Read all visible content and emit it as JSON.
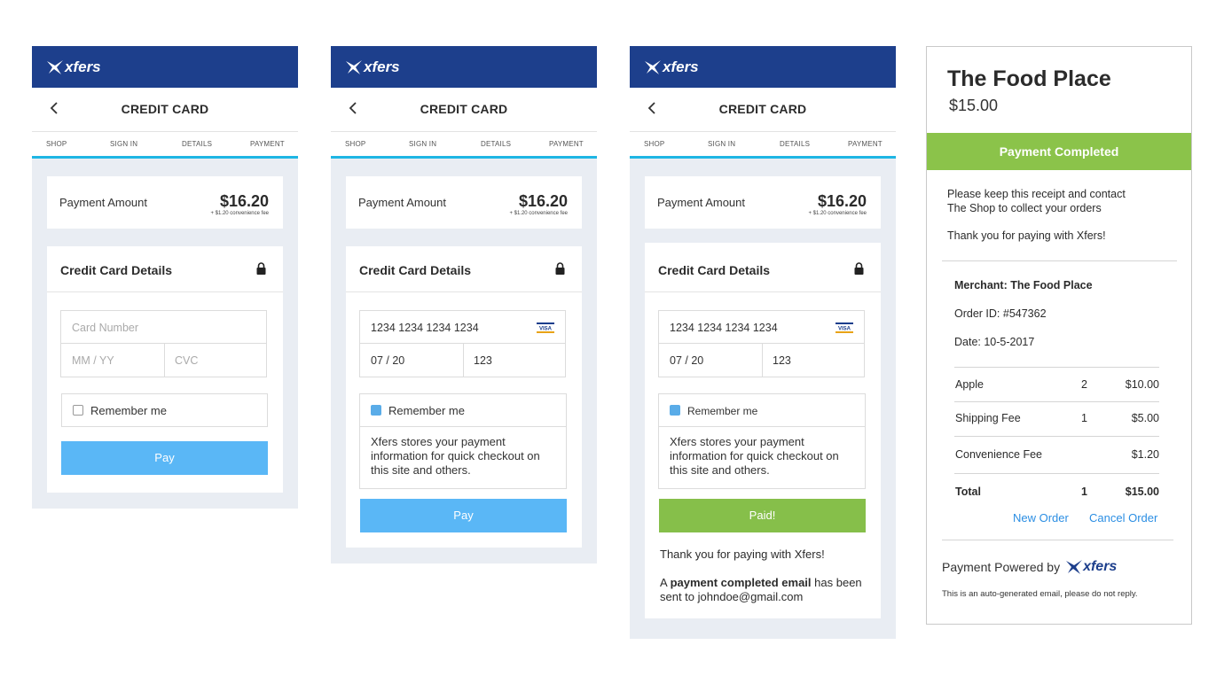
{
  "brand": {
    "logo_text": "xfers",
    "primary_color": "#1d3f8c",
    "accent_color": "#1eb6e4"
  },
  "screens": [
    {
      "title": "CREDIT CARD",
      "back_icon": "chevron-left-icon",
      "steps": [
        "SHOP",
        "SIGN IN",
        "DETAILS",
        "PAYMENT"
      ],
      "amount_label": "Payment Amount",
      "amount_value": "$16.20",
      "amount_fee": "+ $1.20 convenience fee",
      "card_details_title": "Credit Card Details",
      "card_number_placeholder": "Card Number",
      "expiry_placeholder": "MM / YY",
      "cvc_placeholder": "CVC",
      "remember_label": "Remember me",
      "remember_checked": false,
      "pay_label": "Pay"
    },
    {
      "title": "CREDIT CARD",
      "steps": [
        "SHOP",
        "SIGN IN",
        "DETAILS",
        "PAYMENT"
      ],
      "amount_label": "Payment Amount",
      "amount_value": "$16.20",
      "amount_fee": "+ $1.20 convenience fee",
      "card_details_title": "Credit Card Details",
      "card_number": "1234 1234 1234 1234",
      "card_brand": "VISA",
      "expiry": "07 / 20",
      "cvc": "123",
      "remember_label": "Remember me",
      "remember_checked": true,
      "remember_info": "Xfers stores your payment information for quick checkout on this site and others.",
      "pay_label": "Pay"
    },
    {
      "title": "CREDIT CARD",
      "steps": [
        "SHOP",
        "SIGN IN",
        "DETAILS",
        "PAYMENT"
      ],
      "amount_label": "Payment Amount",
      "amount_value": "$16.20",
      "amount_fee": "+ $1.20 convenience fee",
      "card_details_title": "Credit Card Details",
      "card_number": "1234 1234 1234 1234",
      "card_brand": "VISA",
      "expiry": "07 / 20",
      "cvc": "123",
      "remember_label": "Remember me",
      "remember_checked": true,
      "remember_info": "Xfers stores your payment information for quick checkout on this site and others.",
      "paid_label": "Paid!",
      "thanks": "Thank you for paying with Xfers!",
      "email_prefix": "A",
      "email_bold": "payment completed email",
      "email_suffix": "has been sent to johndoe@gmail.com"
    }
  ],
  "receipt": {
    "shop_name": "The Food Place",
    "price": "$15.00",
    "status": "Payment Completed",
    "status_color": "#8bc34a",
    "message": "Please keep this receipt and contact The Shop to collect your orders",
    "thanks": "Thank you for paying with Xfers!",
    "merchant": "Merchant: The Food Place",
    "order_id": "Order ID: #547362",
    "date": "Date: 10-5-2017",
    "items": [
      {
        "name": "Apple",
        "qty": "2",
        "amount": "$10.00"
      },
      {
        "name": "Shipping Fee",
        "qty": "1",
        "amount": "$5.00"
      },
      {
        "name": "Convenience Fee",
        "qty": "",
        "amount": "$1.20"
      }
    ],
    "total": {
      "name": "Total",
      "qty": "1",
      "amount": "$15.00"
    },
    "new_order": "New Order",
    "cancel_order": "Cancel Order",
    "powered_by": "Payment Powered by",
    "auto_note": "This is an auto-generated email, please do not reply."
  }
}
